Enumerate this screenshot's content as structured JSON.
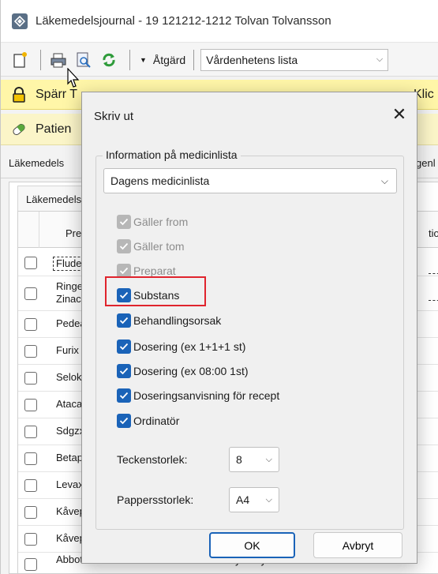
{
  "window": {
    "title": "Läkemedelsjournal - 19 121212-1212 Tolvan Tolvansson"
  },
  "toolbar": {
    "action_label": "Åtgärd",
    "list_value": "Vårdenhetens lista"
  },
  "banners": {
    "lock_text": "Spärr T",
    "patient_text": "Patien",
    "lock_tail": "Klic"
  },
  "tabs": {
    "left_label": "Läkemedels",
    "right_label": "genl",
    "subtab_label": "Läkemedels"
  },
  "grid": {
    "header_col1": "Prepa",
    "header_col2": "tion",
    "rows": [
      {
        "name": "Fluder",
        "name2": ""
      },
      {
        "name": "Ringer",
        "name2": "Zinace"
      },
      {
        "name": "Pedea",
        "name2": ""
      },
      {
        "name": "Furix",
        "name2": ""
      },
      {
        "name": "Seloke",
        "name2": ""
      },
      {
        "name": "Atacar",
        "name2": ""
      },
      {
        "name": "Sdgzx",
        "name2": ""
      },
      {
        "name": "Betap",
        "name2": ""
      },
      {
        "name": "Levax",
        "name2": ""
      },
      {
        "name": "Kåvep",
        "name2": ""
      },
      {
        "name": "Kåvep",
        "name2": ""
      },
      {
        "name": "Abboticin",
        "name2": "Erytromycin"
      }
    ]
  },
  "dialog": {
    "title": "Skriv ut",
    "group_label": "Information på medicinlista",
    "list_value": "Dagens medicinlista",
    "options": [
      {
        "label": "Gäller from",
        "state": "disabled"
      },
      {
        "label": "Gäller tom",
        "state": "disabled"
      },
      {
        "label": "Preparat",
        "state": "disabled"
      },
      {
        "label": "Substans",
        "state": "checked"
      },
      {
        "label": "Behandlingsorsak",
        "state": "checked"
      },
      {
        "label": "Dosering (ex 1+1+1 st)",
        "state": "checked"
      },
      {
        "label": "Dosering (ex 08:00 1st)",
        "state": "checked"
      },
      {
        "label": "Doseringsanvisning för recept",
        "state": "checked"
      },
      {
        "label": "Ordinatör",
        "state": "checked"
      }
    ],
    "font_size_label": "Teckenstorlek:",
    "font_size_value": "8",
    "paper_size_label": "Pappersstorlek:",
    "paper_size_value": "A4",
    "ok_label": "OK",
    "cancel_label": "Avbryt"
  },
  "colors": {
    "accent": "#1a63b8",
    "highlight": "#e0242d",
    "lock_banner": "#fff6a8"
  }
}
